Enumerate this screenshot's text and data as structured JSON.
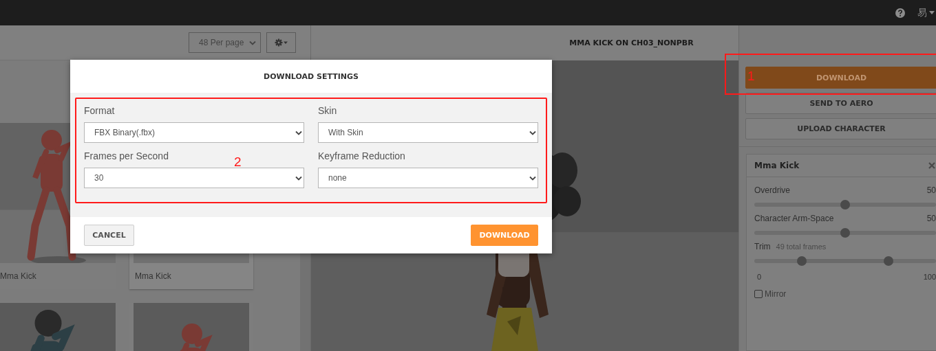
{
  "top_bar": {
    "language": "易"
  },
  "library": {
    "per_page": "48 Per page",
    "cards": [
      {
        "title": "Mma Kick",
        "kind": "picture"
      },
      {
        "title": "Mma Kick",
        "kind": "picture"
      },
      {
        "kind": "picture"
      },
      {
        "kind": "picture"
      }
    ]
  },
  "viewer": {
    "title": "MMA KICK ON CH03_NONPBR",
    "kind": "picture"
  },
  "actions": [
    {
      "label": "DOWNLOAD",
      "kind": "primary"
    },
    {
      "label": "SEND TO AERO",
      "kind": "secondary"
    },
    {
      "label": "UPLOAD CHARACTER",
      "kind": "secondary"
    }
  ],
  "animation_panel": {
    "title": "Mma Kick",
    "controls": [
      {
        "kind": "slider",
        "label": "Overdrive",
        "reading": "50",
        "level": 0.5
      },
      {
        "kind": "slider",
        "label": "Character Arm-Space",
        "reading": "50",
        "level": 0.5
      },
      {
        "kind": "range",
        "label": "Trim",
        "note": "49 total frames",
        "handles": [
          {
            "level": 0.26
          },
          {
            "level": 0.74
          }
        ],
        "min_label": "0",
        "max_label": "100"
      },
      {
        "kind": "checkbox",
        "label": "Mirror",
        "checked": false
      }
    ]
  },
  "dialog": {
    "title": "DOWNLOAD SETTINGS",
    "fields": [
      {
        "label": "Format",
        "value": "FBX Binary(.fbx)"
      },
      {
        "label": "Skin",
        "value": "With Skin"
      },
      {
        "label": "Frames per Second",
        "value": "30"
      },
      {
        "label": "Keyframe Reduction",
        "value": "none"
      }
    ],
    "buttons": [
      {
        "label": "CANCEL",
        "kind": "secondary"
      },
      {
        "label": "DOWNLOAD",
        "kind": "primary"
      }
    ]
  },
  "annotations": [
    {
      "label": "1"
    },
    {
      "label": "2"
    }
  ]
}
